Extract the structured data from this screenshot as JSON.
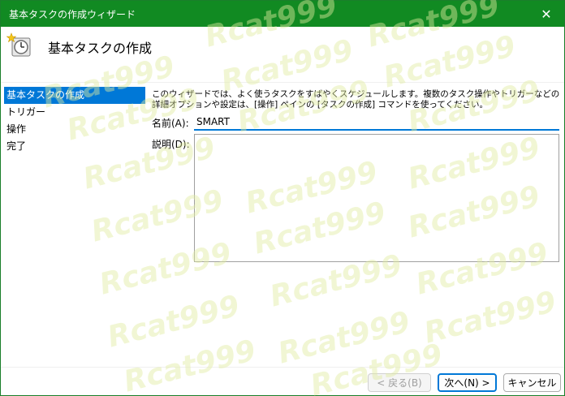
{
  "window": {
    "title": "基本タスクの作成ウィザード",
    "close_label": "✕"
  },
  "header": {
    "title": "基本タスクの作成",
    "icon": "scheduled-task-clock-icon"
  },
  "nav": {
    "items": [
      {
        "label": "基本タスクの作成",
        "active": true
      },
      {
        "label": "トリガー",
        "active": false
      },
      {
        "label": "操作",
        "active": false
      },
      {
        "label": "完了",
        "active": false
      }
    ]
  },
  "main": {
    "description": "このウィザードでは、よく使うタスクをすばやくスケジュールします。複数のタスク操作やトリガーなどの詳細オプションや設定は、[操作] ペインの [タスクの作成] コマンドを使ってください。",
    "name_label": "名前(A):",
    "name_value": "SMART",
    "desc_label": "説明(D):",
    "desc_value": ""
  },
  "buttons": {
    "back": "< 戻る(B)",
    "next": "次へ(N) >",
    "cancel": "キャンセル"
  },
  "watermark_text": "Rcat999",
  "colors": {
    "titlebar": "#118a22",
    "accent": "#0078d7"
  }
}
